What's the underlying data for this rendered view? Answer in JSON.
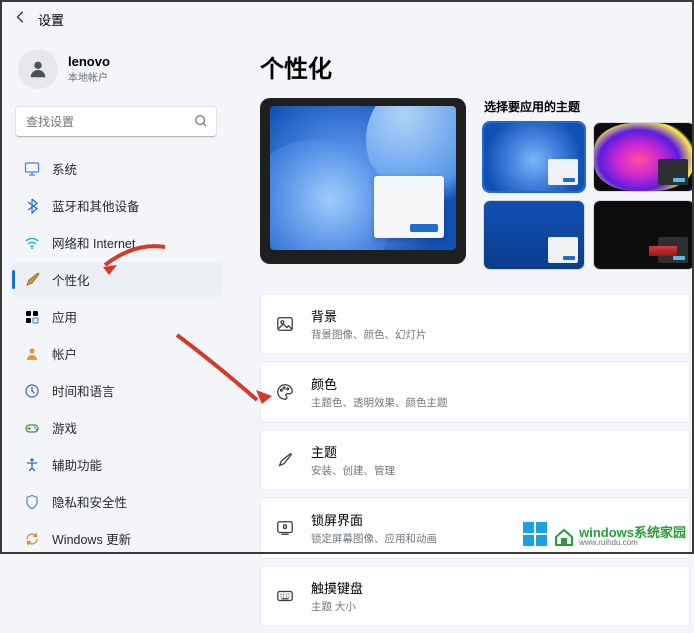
{
  "header": {
    "title": "设置"
  },
  "user": {
    "name": "lenovo",
    "subtitle": "本地帐户"
  },
  "search": {
    "placeholder": "查找设置"
  },
  "sidebar": {
    "items": [
      {
        "label": "系统"
      },
      {
        "label": "蓝牙和其他设备"
      },
      {
        "label": "网络和 Internet"
      },
      {
        "label": "个性化"
      },
      {
        "label": "应用"
      },
      {
        "label": "帐户"
      },
      {
        "label": "时间和语言"
      },
      {
        "label": "游戏"
      },
      {
        "label": "辅助功能"
      },
      {
        "label": "隐私和安全性"
      },
      {
        "label": "Windows 更新"
      }
    ]
  },
  "page": {
    "title": "个性化",
    "themePickerLabel": "选择要应用的主题"
  },
  "settings": {
    "background": {
      "title": "背景",
      "sub": "背景图像、颜色、幻灯片"
    },
    "colors": {
      "title": "颜色",
      "sub": "主题色、透明效果、颜色主题"
    },
    "themes": {
      "title": "主题",
      "sub": "安装、创建、管理"
    },
    "lockscreen": {
      "title": "锁屏界面",
      "sub": "锁定屏幕图像、应用和动画"
    },
    "touchkbd": {
      "title": "触摸键盘",
      "sub": "主题 大小"
    }
  },
  "watermark": {
    "brand": "windows",
    "site": "系统家园",
    "url": "www.ruihdu.com"
  }
}
